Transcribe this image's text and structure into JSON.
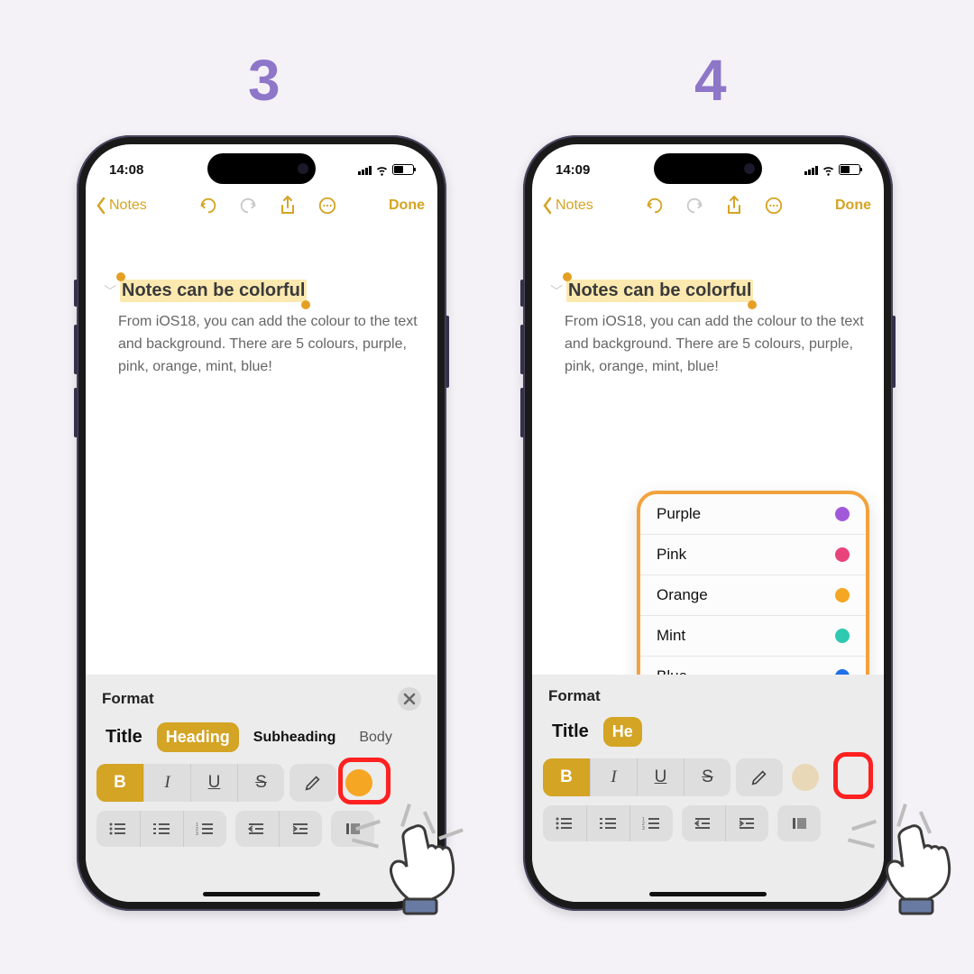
{
  "step_labels": [
    "3",
    "4"
  ],
  "phone3": {
    "time": "14:08",
    "nav_back": "Notes",
    "done": "Done",
    "note_title": "Notes can be colorful",
    "note_body": "From iOS18, you can add the colour to the text and background. There are 5 colours, purple, pink, orange, mint, blue!",
    "format_label": "Format",
    "styles": {
      "title": "Title",
      "heading": "Heading",
      "subheading": "Subheading",
      "body": "Body"
    },
    "biu": {
      "b": "B",
      "i": "I",
      "u": "U",
      "s": "S"
    }
  },
  "phone4": {
    "time": "14:09",
    "nav_back": "Notes",
    "done": "Done",
    "note_title": "Notes can be colorful",
    "note_body": "From iOS18, you can add the colour to the text and background. There are 5 colours, purple, pink, orange, mint, blue!",
    "format_label": "Format",
    "styles": {
      "title": "Title",
      "heading": "He",
      "subheading": "",
      "body": ""
    },
    "biu": {
      "b": "B",
      "i": "I",
      "u": "U",
      "s": "S"
    },
    "colors": [
      {
        "name": "Purple",
        "hex": "#a259d9"
      },
      {
        "name": "Pink",
        "hex": "#e8437a"
      },
      {
        "name": "Orange",
        "hex": "#f5a623"
      },
      {
        "name": "Mint",
        "hex": "#2ec9b0"
      },
      {
        "name": "Blue",
        "hex": "#2070e8"
      }
    ]
  }
}
